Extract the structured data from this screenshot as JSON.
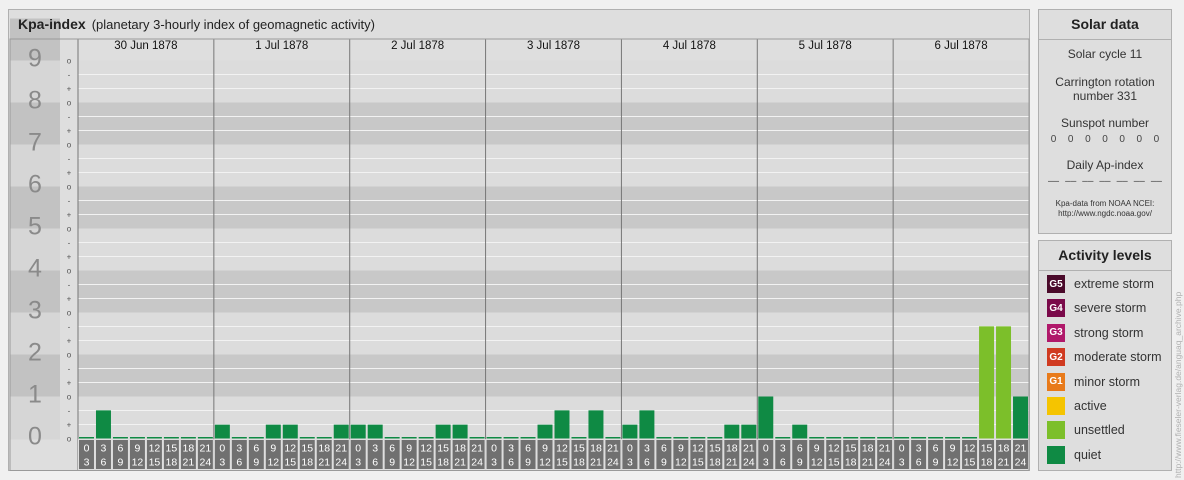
{
  "title": {
    "main": "Kpa-index",
    "sub": "(planetary 3-hourly index of geomagnetic activity)"
  },
  "solar": {
    "heading": "Solar data",
    "cycle": "Solar cycle 11",
    "carrington_line1": "Carrington rotation",
    "carrington_line2": "number 331",
    "sunspot_label": "Sunspot number",
    "sunspot_values": [
      "0",
      "0",
      "0",
      "0",
      "0",
      "0",
      "0"
    ],
    "ap_label": "Daily Ap-index",
    "ap_values": [
      "––",
      "––",
      "––",
      "––",
      "––",
      "––",
      "––"
    ],
    "source_line1": "Kpa-data from NOAA NCEI:",
    "source_line2": "http://www.ngdc.noaa.gov/"
  },
  "activity": {
    "heading": "Activity levels",
    "items": [
      {
        "code": "G5",
        "label": "extreme storm",
        "color": "#4a0a2a"
      },
      {
        "code": "G4",
        "label": "severe storm",
        "color": "#7a0a4a"
      },
      {
        "code": "G3",
        "label": "strong storm",
        "color": "#b0186a"
      },
      {
        "code": "G2",
        "label": "moderate storm",
        "color": "#d03a20"
      },
      {
        "code": "G1",
        "label": "minor storm",
        "color": "#e87a1a"
      },
      {
        "code": "",
        "label": "active",
        "color": "#f5c400"
      },
      {
        "code": "",
        "label": "unsettled",
        "color": "#7cbf2a"
      },
      {
        "code": "",
        "label": "quiet",
        "color": "#0f8a44"
      }
    ]
  },
  "watermark": "http://www.fieseler-verlag.de/anguaq_archive.php",
  "chart_data": {
    "type": "bar",
    "title": "Kpa-index",
    "ylabel": "",
    "ylim": [
      0,
      9
    ],
    "y_ticks": [
      "0",
      "1",
      "2",
      "3",
      "4",
      "5",
      "6",
      "7",
      "8",
      "9"
    ],
    "minor_marks": [
      "o",
      "+",
      "-"
    ],
    "days": [
      "30 Jun 1878",
      "1 Jul 1878",
      "2 Jul 1878",
      "3 Jul 1878",
      "4 Jul 1878",
      "5 Jul 1878",
      "6 Jul 1878"
    ],
    "interval_start": [
      "0",
      "3",
      "6",
      "9",
      "12",
      "15",
      "18",
      "21"
    ],
    "interval_end": [
      "3",
      "6",
      "9",
      "12",
      "15",
      "18",
      "21",
      "24"
    ],
    "colors": {
      "quiet": "#0f8a44",
      "unsettled": "#7cbf2a"
    },
    "series": [
      {
        "values": [
          0,
          0.67,
          0,
          0,
          0,
          0,
          0,
          0,
          0.33,
          0,
          0,
          0.33,
          0.33,
          0,
          0,
          0.33,
          0.33,
          0.33,
          0,
          0,
          0,
          0.33,
          0.33,
          0,
          0,
          0,
          0,
          0.33,
          0.67,
          0,
          0.67,
          0,
          0.33,
          0.67,
          0,
          0,
          0,
          0,
          0.33,
          0.33,
          1,
          0,
          0.33,
          0,
          0,
          0,
          0,
          0,
          0,
          0,
          0,
          0,
          0,
          2.67,
          2.67,
          1
        ]
      }
    ]
  }
}
